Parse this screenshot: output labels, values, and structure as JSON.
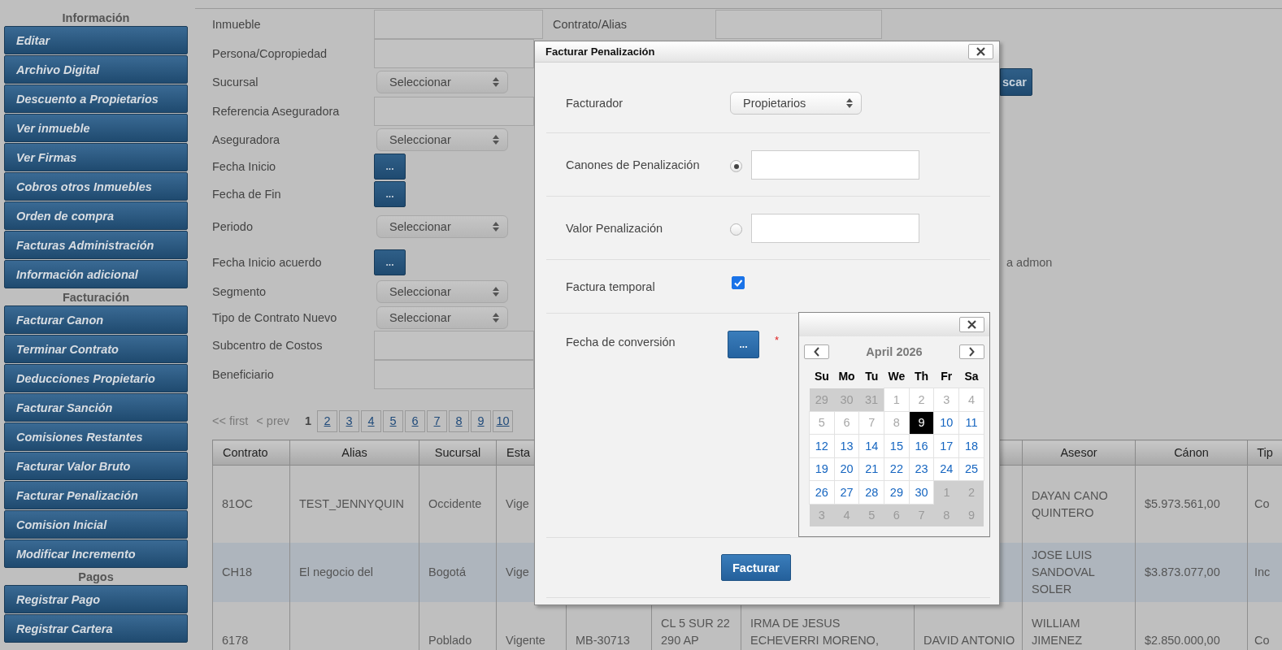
{
  "sidebar": {
    "sections": [
      {
        "title": "Información",
        "items": [
          "Editar",
          "Archivo Digital",
          "Descuento a Propietarios",
          "Ver inmueble",
          "Ver Firmas",
          "Cobros otros Inmuebles",
          "Orden de compra",
          "Facturas Administración",
          "Información adicional"
        ]
      },
      {
        "title": "Facturación",
        "items": [
          "Facturar Canon",
          "Terminar Contrato",
          "Deducciones Propietario",
          "Facturar Sanción",
          "Comisiones Restantes",
          "Facturar Valor Bruto",
          "Facturar Penalización",
          "Comision Inicial",
          "Modificar Incremento"
        ]
      },
      {
        "title": "Pagos",
        "items": [
          "Registrar Pago",
          "Registrar Cartera"
        ]
      }
    ]
  },
  "form": {
    "left": [
      {
        "label": "Inmueble",
        "kind": "text"
      },
      {
        "label": "Persona/Copropiedad",
        "kind": "text"
      },
      {
        "label": "Sucursal",
        "kind": "select",
        "value": "Seleccionar"
      },
      {
        "label": "Referencia Aseguradora",
        "kind": "text"
      },
      {
        "label": "Aseguradora",
        "kind": "select",
        "value": "Seleccionar"
      },
      {
        "label": "Fecha Inicio",
        "kind": "date",
        "value": "..."
      },
      {
        "label": "Fecha de Fin",
        "kind": "date",
        "value": "..."
      },
      {
        "label": "Periodo",
        "kind": "select",
        "value": "Seleccionar"
      },
      {
        "label": "Fecha Inicio acuerdo",
        "kind": "date",
        "value": "..."
      },
      {
        "label": "Segmento",
        "kind": "select",
        "value": "Seleccionar"
      },
      {
        "label": "Tipo de Contrato Nuevo",
        "kind": "select",
        "value": "Seleccionar"
      },
      {
        "label": "Subcentro de Costos",
        "kind": "text"
      },
      {
        "label": "Beneficiario",
        "kind": "text"
      }
    ],
    "right": [
      {
        "label": "Contrato/Alias",
        "kind": "text"
      }
    ],
    "search_button": "scar",
    "note": "a admon"
  },
  "pagination": {
    "first": {
      "label": "<< first",
      "disabled": true
    },
    "prev": {
      "label": "< prev",
      "disabled": true
    },
    "pages": [
      {
        "label": "1",
        "selected": true
      },
      {
        "label": "2",
        "selected": false
      },
      {
        "label": "3",
        "selected": false
      },
      {
        "label": "4",
        "selected": false
      },
      {
        "label": "5",
        "selected": false
      },
      {
        "label": "6",
        "selected": false
      },
      {
        "label": "7",
        "selected": false
      },
      {
        "label": "8",
        "selected": false
      },
      {
        "label": "9",
        "selected": false
      },
      {
        "label": "10",
        "selected": false
      }
    ]
  },
  "table": {
    "columns": [
      {
        "label": "Contrato"
      },
      {
        "label": "Alias"
      },
      {
        "label": "Sucursal"
      },
      {
        "label": "Esta"
      },
      {},
      {},
      {},
      {},
      {
        "label": "Asesor"
      },
      {
        "label": "Cánon"
      },
      {
        "label": "Tip"
      }
    ],
    "rows": [
      {
        "selected": false,
        "cells": [
          "81OC",
          "TEST_JENNYQUIN",
          "Occidente",
          "Vige",
          null,
          null,
          null,
          null,
          "DAYAN CANO QUINTERO",
          "$5.973.561,00",
          "Co"
        ]
      },
      {
        "selected": true,
        "cells": [
          "CH18",
          "El negocio del",
          "Bogotá",
          "Vige",
          null,
          null,
          null,
          null,
          "JOSE LUIS SANDOVAL SOLER",
          "$3.873.077,00",
          "Inc"
        ]
      },
      {
        "selected": false,
        "cells": [
          "6178",
          null,
          "Poblado",
          "Vigente",
          "MB-30713",
          "CL 5 SUR 22 290 AP",
          "IRMA DE JESUS ECHEVERRI MORENO,",
          "DAVID ANTONIO",
          "WILLIAM JIMENEZ",
          "$2.850.000,00",
          "Co"
        ]
      }
    ]
  },
  "modal": {
    "title": "Facturar Penalización",
    "rows": [
      {
        "label": "Facturador",
        "kind": "select",
        "value": "Propietarios"
      },
      {
        "label": "Canones de Penalización",
        "kind": "radio",
        "selected": true
      },
      {
        "label": "Valor Penalización",
        "kind": "radio",
        "selected": false
      },
      {
        "label": "Factura temporal",
        "kind": "checkbox",
        "checked": true
      },
      {
        "label": "Fecha de conversión",
        "kind": "date",
        "value": "...",
        "required_mark": "*"
      }
    ],
    "submit": "Facturar"
  },
  "calendar": {
    "title": "April 2026",
    "weekdays": [
      "Su",
      "Mo",
      "Tu",
      "We",
      "Th",
      "Fr",
      "Sa"
    ],
    "weeks": [
      [
        {
          "day": "29",
          "kind": "other",
          "selected": false
        },
        {
          "day": "30",
          "kind": "other",
          "selected": false
        },
        {
          "day": "31",
          "kind": "other",
          "selected": false
        },
        {
          "day": "1",
          "kind": "disabled",
          "selected": false
        },
        {
          "day": "2",
          "kind": "disabled",
          "selected": false
        },
        {
          "day": "3",
          "kind": "disabled",
          "selected": false
        },
        {
          "day": "4",
          "kind": "disabled",
          "selected": false
        }
      ],
      [
        {
          "day": "5",
          "kind": "disabled",
          "selected": false
        },
        {
          "day": "6",
          "kind": "disabled",
          "selected": false
        },
        {
          "day": "7",
          "kind": "disabled",
          "selected": false
        },
        {
          "day": "8",
          "kind": "disabled",
          "selected": false
        },
        {
          "day": "9",
          "kind": "available",
          "selected": true
        },
        {
          "day": "10",
          "kind": "available",
          "selected": false
        },
        {
          "day": "11",
          "kind": "available",
          "selected": false
        }
      ],
      [
        {
          "day": "12",
          "kind": "available",
          "selected": false
        },
        {
          "day": "13",
          "kind": "available",
          "selected": false
        },
        {
          "day": "14",
          "kind": "available",
          "selected": false
        },
        {
          "day": "15",
          "kind": "available",
          "selected": false
        },
        {
          "day": "16",
          "kind": "available",
          "selected": false
        },
        {
          "day": "17",
          "kind": "available",
          "selected": false
        },
        {
          "day": "18",
          "kind": "available",
          "selected": false
        }
      ],
      [
        {
          "day": "19",
          "kind": "available",
          "selected": false
        },
        {
          "day": "20",
          "kind": "available",
          "selected": false
        },
        {
          "day": "21",
          "kind": "available",
          "selected": false
        },
        {
          "day": "22",
          "kind": "available",
          "selected": false
        },
        {
          "day": "23",
          "kind": "available",
          "selected": false
        },
        {
          "day": "24",
          "kind": "available",
          "selected": false
        },
        {
          "day": "25",
          "kind": "available",
          "selected": false
        }
      ],
      [
        {
          "day": "26",
          "kind": "available",
          "selected": false
        },
        {
          "day": "27",
          "kind": "available",
          "selected": false
        },
        {
          "day": "28",
          "kind": "available",
          "selected": false
        },
        {
          "day": "29",
          "kind": "available",
          "selected": false
        },
        {
          "day": "30",
          "kind": "available",
          "selected": false
        },
        {
          "day": "1",
          "kind": "other",
          "selected": false
        },
        {
          "day": "2",
          "kind": "other",
          "selected": false
        }
      ],
      [
        {
          "day": "3",
          "kind": "other",
          "selected": false
        },
        {
          "day": "4",
          "kind": "other",
          "selected": false
        },
        {
          "day": "5",
          "kind": "other",
          "selected": false
        },
        {
          "day": "6",
          "kind": "other",
          "selected": false
        },
        {
          "day": "7",
          "kind": "other",
          "selected": false
        },
        {
          "day": "8",
          "kind": "other",
          "selected": false
        },
        {
          "day": "9",
          "kind": "other",
          "selected": false
        }
      ]
    ]
  }
}
